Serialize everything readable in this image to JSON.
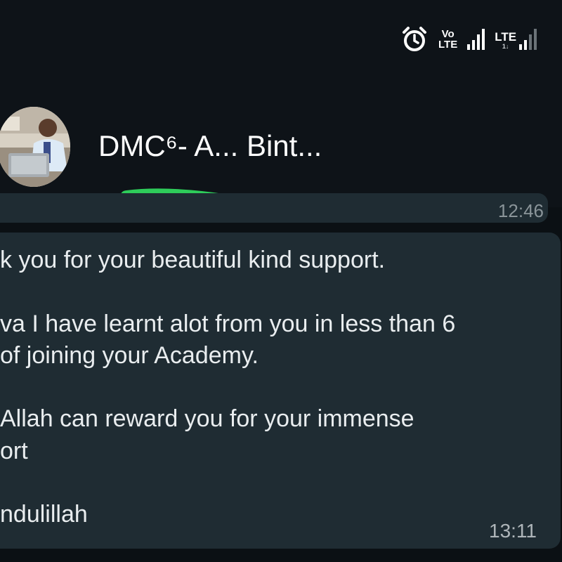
{
  "status_bar": {
    "icons": [
      "alarm-icon",
      "volte-icon",
      "signal-icon",
      "lte-icon",
      "signal-icon"
    ],
    "volte_top": "Vo",
    "volte_bottom": "LTE",
    "lte_label": "LTE",
    "lte_sub": "1↓"
  },
  "header": {
    "contact_name": "DMC⁶- A... Bint...",
    "icons": [
      "avatar",
      "video-call-icon",
      "phone-call-icon"
    ]
  },
  "chat": {
    "previous_message_time": "12:46",
    "message": {
      "lines": [
        "k you for your beautiful kind support.",
        "",
        "va I have learnt alot from you in less than 6",
        "of joining your Academy.",
        "",
        "Allah can reward you for your immense",
        "ort",
        "",
        "ndulillah"
      ],
      "time": "13:11"
    }
  },
  "colors": {
    "background": "#0b1014",
    "header": "#0e1318",
    "bubble": "#1f2c33",
    "text": "#e9edef",
    "scribble": "#2ecc5a"
  }
}
